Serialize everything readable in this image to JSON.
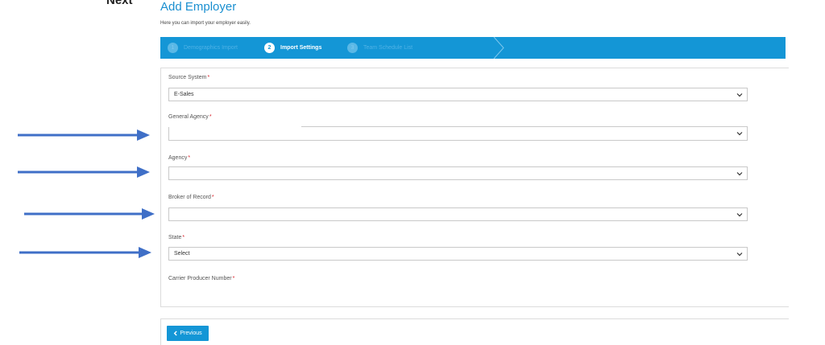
{
  "corner_text": "Next",
  "header": {
    "title": "Add Employer",
    "subtitle": "Here you can import your employer easily."
  },
  "stepper": {
    "steps": [
      {
        "number": "1",
        "label": "Demographics Import",
        "state": "inactive"
      },
      {
        "number": "2",
        "label": "Import Settings",
        "state": "active"
      },
      {
        "number": "3",
        "label": "Team Schedule List",
        "state": "inactive"
      }
    ]
  },
  "form": {
    "source_system": {
      "label": "Source System",
      "value": "E-Sales"
    },
    "general_agency": {
      "label": "General Agency",
      "value": ""
    },
    "agency": {
      "label": "Agency",
      "value": ""
    },
    "broker_of_record": {
      "label": "Broker of Record",
      "value": ""
    },
    "state": {
      "label": "State",
      "value": "Select"
    },
    "carrier_producer_number": {
      "label": "Carrier Producer Number"
    },
    "required_mark": "*"
  },
  "footer": {
    "previous_label": "Previous"
  },
  "colors": {
    "accent": "#1496d6",
    "title": "#1a8fd0",
    "required": "#d9222a",
    "annotation_arrow": "#3f6fc7"
  },
  "icons": {
    "select_chevron": "chevron-down-icon",
    "previous": "chevron-left-icon",
    "annotation": "arrow-right-icon"
  }
}
